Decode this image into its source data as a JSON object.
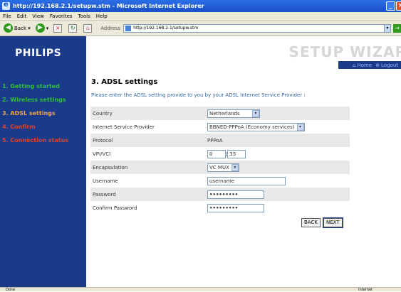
{
  "window": {
    "title": "http://192.168.2.1/setupw.stm - Microsoft Internet Explorer"
  },
  "menu": [
    "File",
    "Edit",
    "View",
    "Favorites",
    "Tools",
    "Help"
  ],
  "toolbar": {
    "back_label": "Back",
    "address_label": "Address",
    "address_value": "http://192.168.2.1/setupw.stm"
  },
  "header": {
    "logo": "PHILIPS",
    "wizard_title": "SETUP WIZAR",
    "home_label": "Home",
    "logout_label": "Logout"
  },
  "sidebar": {
    "items": [
      {
        "label": "1. Getting started",
        "color": "#2fbf3c"
      },
      {
        "label": "2. Wireless settings",
        "color": "#2fbf3c"
      },
      {
        "label": "3. ADSL settings",
        "color": "#f0a040"
      },
      {
        "label": "4. Confirm",
        "color": "#e0402a"
      },
      {
        "label": "5. Connection status",
        "color": "#e0402a"
      }
    ]
  },
  "main": {
    "title": "3. ADSL settings",
    "intro": "Please enter the ADSL setting provide to you by your ADSL Internet Service Provider :",
    "fields": {
      "country": {
        "label": "Country",
        "value": "Netherlands"
      },
      "isp": {
        "label": "Internet Service Provider",
        "value": "BBNED-PPPoA (Economy services)"
      },
      "protocol": {
        "label": "Protocol",
        "value": "PPPoA"
      },
      "vpivci": {
        "label": "VPI/VCI",
        "vpi": "0",
        "separator": "/",
        "vci": "35"
      },
      "encapsulation": {
        "label": "Encapsulation",
        "value": "VC MUX"
      },
      "username": {
        "label": "Username",
        "value": "username"
      },
      "password": {
        "label": "Password",
        "value": "•••••••••"
      },
      "confirm_password": {
        "label": "Confirm Password",
        "value": "•••••••••"
      }
    },
    "back_label": "BACK",
    "next_label": "NEXT"
  },
  "status": {
    "text": "Done",
    "zone": "Internet"
  },
  "colors": {
    "brand_blue": "#1a3a8a",
    "intro_blue": "#3366aa"
  }
}
